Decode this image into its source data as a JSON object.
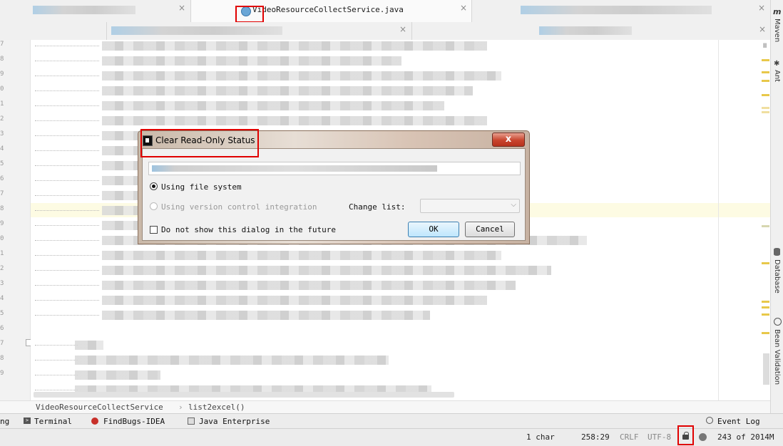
{
  "tabs": {
    "active_label": "VideoResourceCollectService.java",
    "close_glyph": "×"
  },
  "dialog": {
    "title": "Clear Read-Only Status",
    "close_glyph": "x",
    "option_file_system": "Using file system",
    "option_vcs": "Using version control integration",
    "change_list_label": "Change list:",
    "change_list_value": "",
    "checkbox_label": "Do not show this dialog in the future",
    "ok_label": "OK",
    "cancel_label": "Cancel",
    "selected_option": "file-system",
    "do_not_show_checked": false
  },
  "right_sidebar": {
    "maven": "Maven",
    "ant": "Ant",
    "database": "Database",
    "bean_validation": "Bean Validation"
  },
  "breadcrumb": {
    "class_name": "VideoResourceCollectService",
    "separator": "›",
    "method": "list2excel()"
  },
  "tool_windows": {
    "partial": "ng",
    "terminal": "Terminal",
    "findbugs": "FindBugs-IDEA",
    "java_enterprise": "Java Enterprise",
    "event_log": "Event Log"
  },
  "status_bar": {
    "selection": "1 char",
    "caret": "258:29",
    "line_separator": "CRLF",
    "encoding": "UTF-8",
    "memory": "243 of 2014M"
  },
  "gutter": {
    "line_digits": [
      "7",
      "8",
      "9",
      "0",
      "1",
      "2",
      "3",
      "4",
      "5",
      "6",
      "7",
      "8",
      "9",
      "0",
      "1",
      "2",
      "3",
      "4",
      "5",
      "6",
      "7",
      "8",
      "9"
    ]
  },
  "colors": {
    "highlight_annotation": "#e00000",
    "current_line": "#fdfbe3",
    "warning_stripe": "#e8c84a"
  }
}
